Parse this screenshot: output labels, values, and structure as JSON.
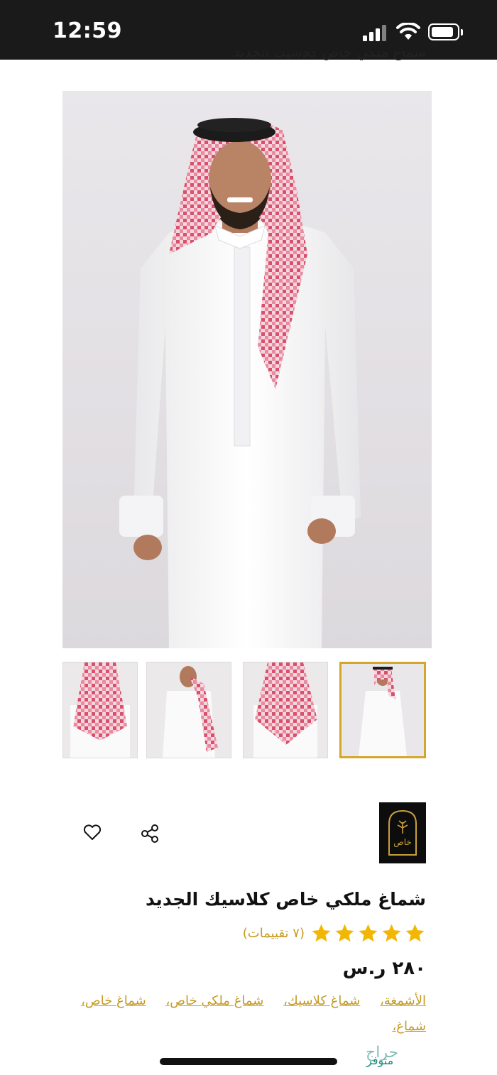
{
  "status_bar": {
    "time": "12:59"
  },
  "header": {
    "cut_title": "شماغ ملكي خاص كلاسيك الجديد"
  },
  "gallery": {
    "main_image": "man-in-thobe-red-shemagh",
    "thumbnails": [
      {
        "name": "shemagh-back-view"
      },
      {
        "name": "shemagh-draped-view"
      },
      {
        "name": "shemagh-back-view-2"
      },
      {
        "name": "man-in-thobe-full",
        "active": true
      }
    ]
  },
  "brand": {
    "logo_text": "خاص"
  },
  "actions": {
    "share_icon": "share-icon",
    "favorite_icon": "heart-icon"
  },
  "product": {
    "title": "شماغ ملكي خاص كلاسيك الجديد",
    "rating_stars": 5,
    "rating_count": "(٧ تقييمات)",
    "price": "٢٨٠ ر.س",
    "tags": [
      "الأشمغة،",
      "شماغ كلاسيك،",
      "شماغ ملكي خاص،",
      "شماغ خاص،",
      "شماغ،"
    ]
  },
  "watermark": {
    "text": "حراج",
    "sub": "متوفر"
  },
  "colors": {
    "accent": "#d4a62a",
    "tag": "#c49a22",
    "star": "#f2b705"
  }
}
